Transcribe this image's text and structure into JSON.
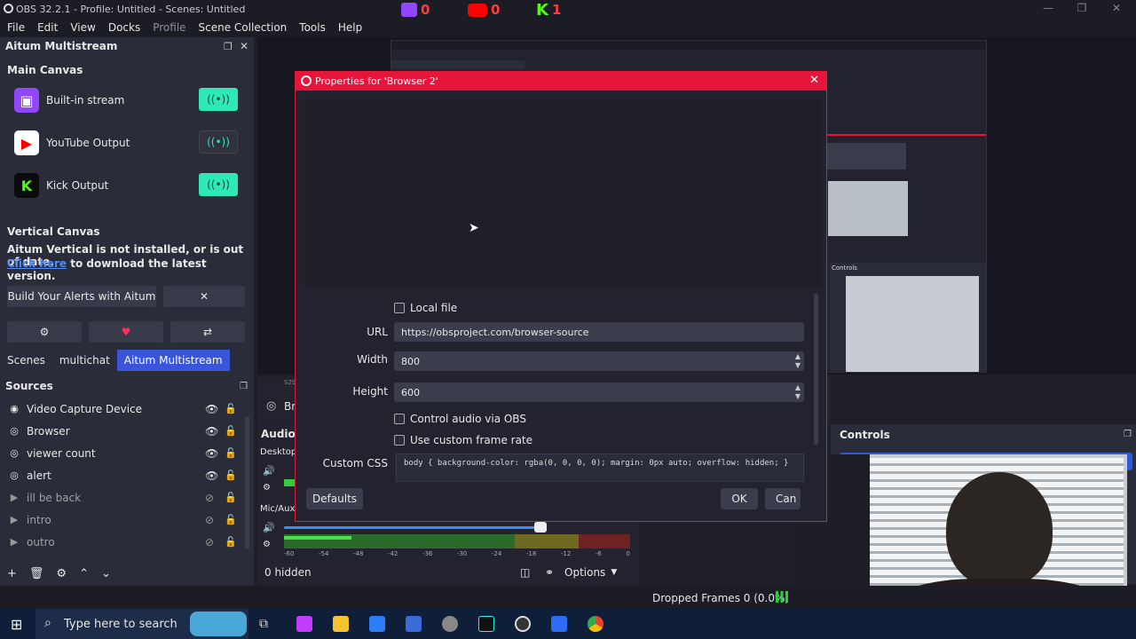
{
  "window": {
    "title": "OBS 32.2.1 - Profile: Untitled - Scenes: Untitled"
  },
  "platform_counters": [
    {
      "name": "twitch",
      "count": "0",
      "color": "#9146ff"
    },
    {
      "name": "youtube",
      "count": "0",
      "color": "#ff0000"
    },
    {
      "name": "kick",
      "count": "1",
      "color": "#53fc18"
    }
  ],
  "menu": [
    "File",
    "Edit",
    "View",
    "Docks",
    "Profile",
    "Scene Collection",
    "Tools",
    "Help"
  ],
  "aitum": {
    "title": "Aitum Multistream",
    "main_canvas": "Main Canvas",
    "outputs": [
      {
        "label": "Built-in stream",
        "icon": "twitch-icon",
        "glyph": "▣",
        "color": "#9146ff",
        "state": "on"
      },
      {
        "label": "YouTube Output",
        "icon": "youtube-icon",
        "glyph": "▶",
        "color": "#ff0000",
        "state": "off"
      },
      {
        "label": "Kick Output",
        "icon": "kick-icon",
        "glyph": "K",
        "color": "#53fc18",
        "state": "on"
      }
    ],
    "broadcast_glyph": "((•))",
    "vertical_canvas": "Vertical Canvas",
    "vertical_msg": "Aitum Vertical is not installed, or is out of date.",
    "click_here": "Click here",
    "download_msg": " to download the latest version.",
    "alerts_button": "Build Your Alerts with Aitum",
    "close_glyph": "✕",
    "gear_glyph": "⚙",
    "heart_glyph": "♥",
    "share_glyph": "⇄"
  },
  "tabs": [
    {
      "label": "Scenes",
      "active": false
    },
    {
      "label": "multichat",
      "active": false
    },
    {
      "label": "Aitum Multistream",
      "active": true
    }
  ],
  "sources": {
    "title": "Sources",
    "items": [
      {
        "name": "Video Capture Device",
        "glyph": "◉",
        "visible": true
      },
      {
        "name": "Browser",
        "glyph": "◎",
        "visible": true
      },
      {
        "name": "viewer count",
        "glyph": "◎",
        "visible": true
      },
      {
        "name": "alert",
        "glyph": "◎",
        "visible": true
      },
      {
        "name": "ill be back",
        "glyph": "▶",
        "visible": false
      },
      {
        "name": "intro",
        "glyph": "▶",
        "visible": false
      },
      {
        "name": "outro",
        "glyph": "▶",
        "visible": false
      }
    ],
    "eye_on": "👁",
    "eye_off": "⊘",
    "lock": "🔓",
    "toolbar": [
      "+",
      "🗑",
      "⚙",
      "⌃",
      "⌄"
    ]
  },
  "dialog": {
    "title": "Properties for 'Browser 2'",
    "local_file": "Local file",
    "url_label": "URL",
    "url_value": "https://obsproject.com/browser-source",
    "width_label": "Width",
    "width_value": "800",
    "height_label": "Height",
    "height_value": "600",
    "control_audio": "Control audio via OBS",
    "custom_frame_rate": "Use custom frame rate",
    "css_label": "Custom CSS",
    "css_value": "body { background-color: rgba(0, 0, 0, 0); margin: 0px auto; overflow: hidden; }",
    "defaults": "Defaults",
    "ok": "OK",
    "cancel": "Can"
  },
  "audio": {
    "title": "Audio I",
    "desktop": "Desktop",
    "mic": "Mic/Aux",
    "scale": [
      "-60",
      "-54",
      "-48",
      "-42",
      "-36",
      "-30",
      "-24",
      "-18",
      "-12",
      "-6",
      "0"
    ],
    "hidden_count": "0 hidden",
    "options": "Options",
    "br": "Br",
    "s29": "S29"
  },
  "controls": {
    "title": "Controls"
  },
  "nested_controls": "Controls",
  "status": {
    "dropped_frames": "Dropped Frames 0 (0.0%)"
  },
  "taskbar": {
    "search_placeholder": "Type here to search"
  }
}
